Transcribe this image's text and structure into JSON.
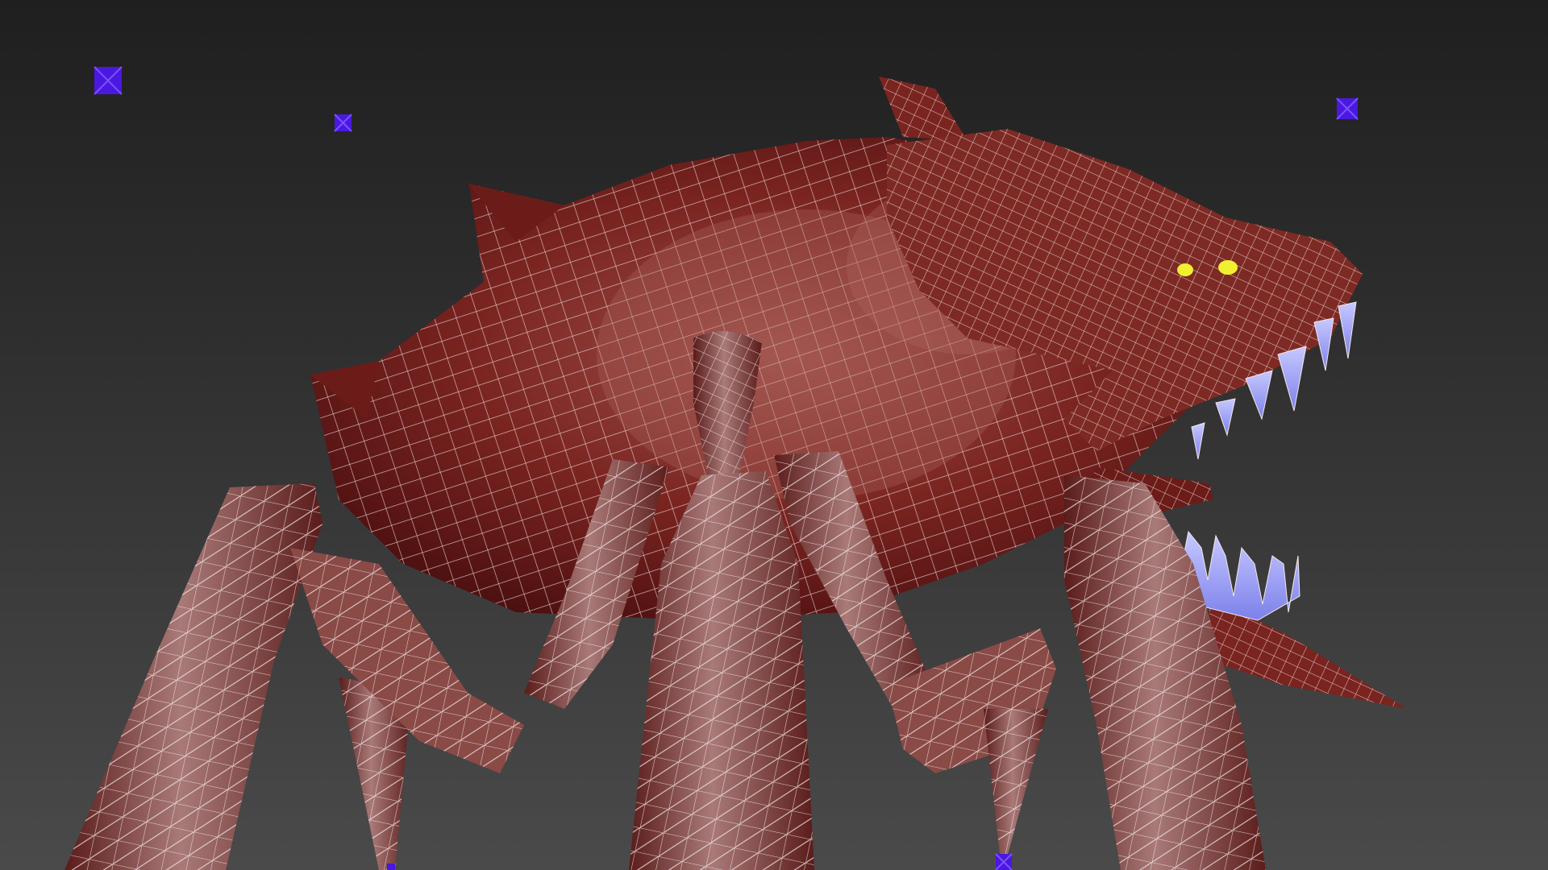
{
  "viewport": {
    "stats_text": "",
    "background_top": "#1f1f1f",
    "background_bottom": "#4a4a4a"
  },
  "colors": {
    "wire": "#f4e8e8",
    "skin_dark": "#4d1010",
    "skin_mid": "#7a2420",
    "skin_light": "#a0524c",
    "leg_light": "#a97a78",
    "teeth": "#8f92f0",
    "eye": "#f0f030",
    "helper": "#4a18e0"
  },
  "model": {
    "name_icon": "creature-mesh",
    "eyes_icon": "eye-highlight-icon",
    "teeth_icon": "teeth-icon"
  },
  "helpers": [
    {
      "icon": "helper-dummy-icon"
    },
    {
      "icon": "helper-dummy-icon"
    },
    {
      "icon": "helper-dummy-icon"
    },
    {
      "icon": "helper-dummy-icon"
    },
    {
      "icon": "helper-dummy-icon"
    }
  ]
}
